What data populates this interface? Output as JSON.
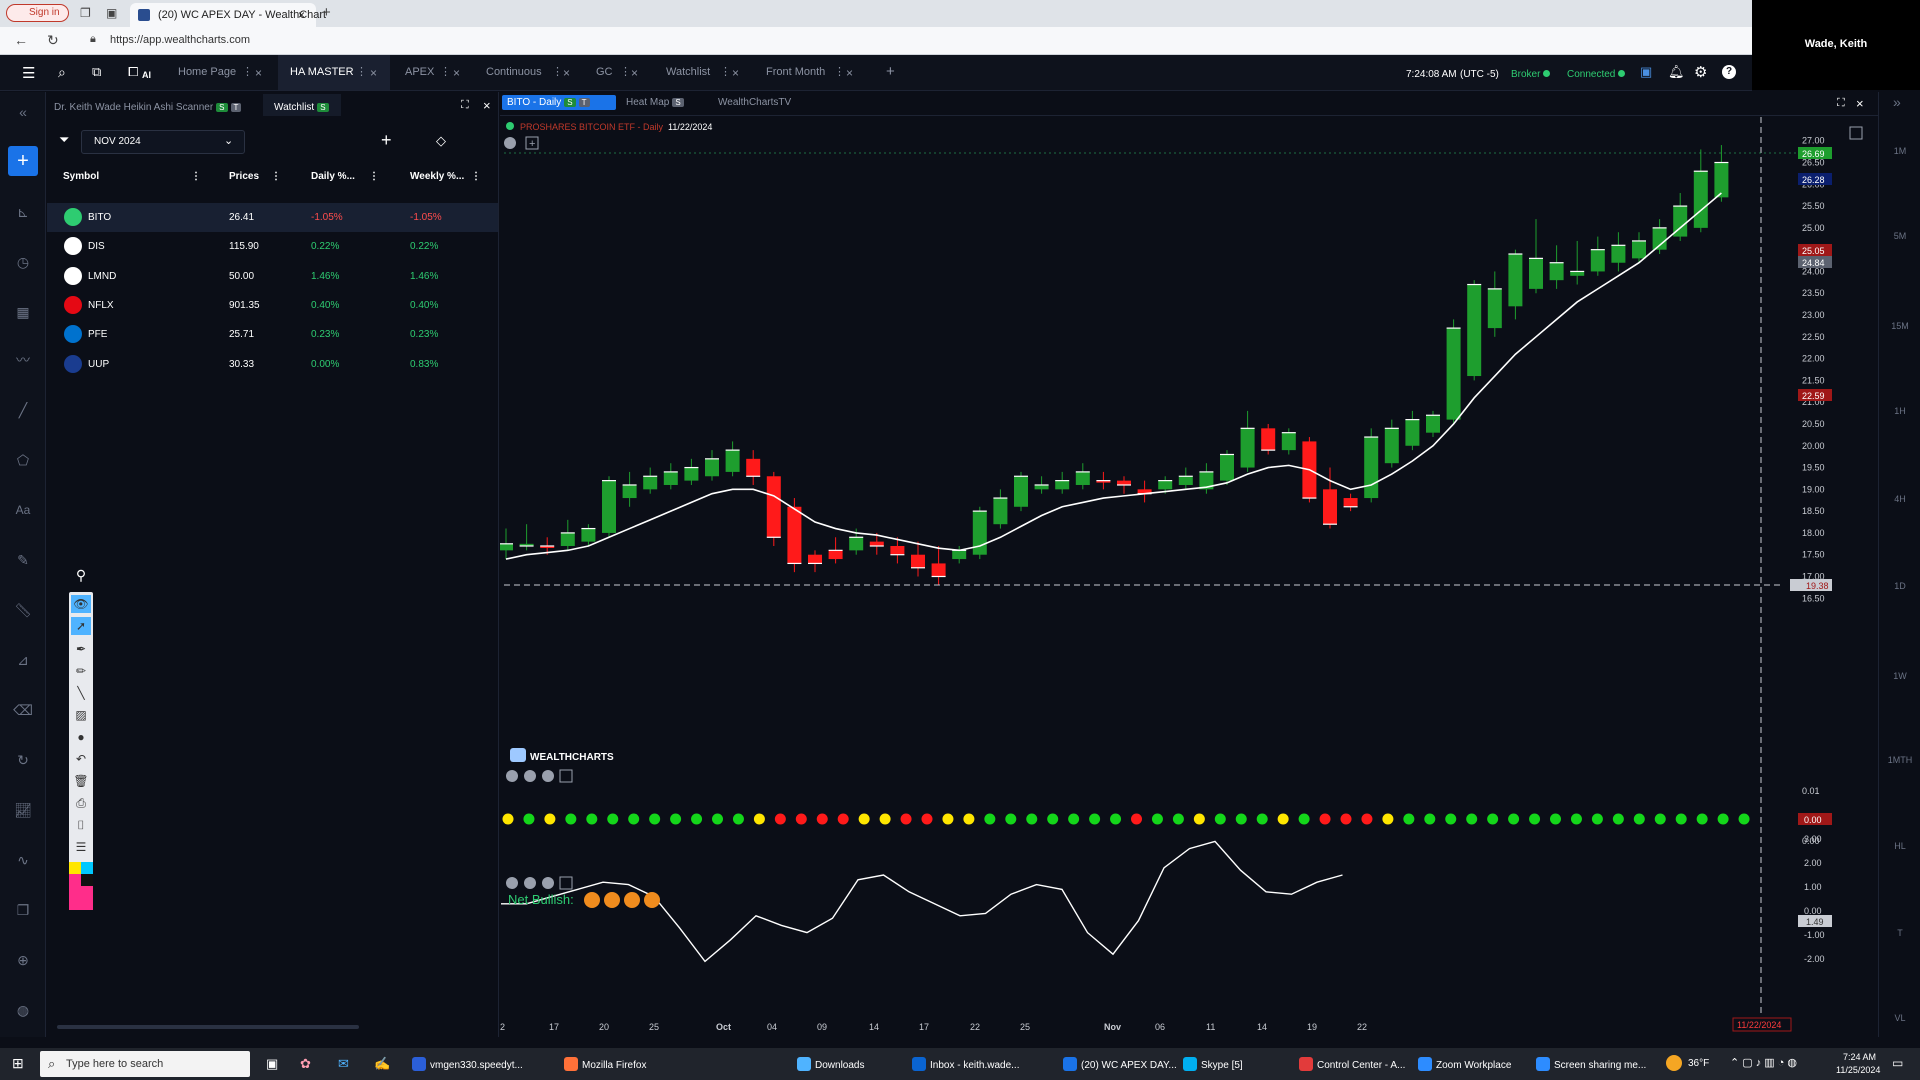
{
  "browser": {
    "signin_label": "Sign in",
    "tab_title": "(20) WC APEX DAY - WealthChart",
    "url": "https://app.wealthcharts.com",
    "user_name": "Wade, Keith"
  },
  "topbar": {
    "ai_label": "AI",
    "tabs": [
      {
        "label": "Home Page"
      },
      {
        "label": "HA MASTER"
      },
      {
        "label": "APEX"
      },
      {
        "label": "Continuous"
      },
      {
        "label": "GC"
      },
      {
        "label": "Watchlist"
      },
      {
        "label": "Front Month"
      }
    ],
    "time": "7:24:08 AM",
    "tz": "(UTC -5)",
    "broker": "Broker",
    "connected": "Connected"
  },
  "watchlist": {
    "scanner_tab": "Dr. Keith Wade Heikin Ashi Scanner",
    "watchlist_tab": "Watchlist",
    "badge_s": "S",
    "badge_t": "T",
    "month": "NOV 2024",
    "columns": [
      "Symbol",
      "Prices",
      "Daily %...",
      "Weekly %..."
    ],
    "rows": [
      {
        "symbol": "BITO",
        "price": "26.41",
        "daily": "-1.05%",
        "weekly": "-1.05%",
        "dir": "down"
      },
      {
        "symbol": "DIS",
        "price": "115.90",
        "daily": "0.22%",
        "weekly": "0.22%",
        "dir": "up"
      },
      {
        "symbol": "LMND",
        "price": "50.00",
        "daily": "1.46%",
        "weekly": "1.46%",
        "dir": "up"
      },
      {
        "symbol": "NFLX",
        "price": "901.35",
        "daily": "0.40%",
        "weekly": "0.40%",
        "dir": "up"
      },
      {
        "symbol": "PFE",
        "price": "25.71",
        "daily": "0.23%",
        "weekly": "0.23%",
        "dir": "up"
      },
      {
        "symbol": "UUP",
        "price": "30.33",
        "daily": "0.00%",
        "weekly": "0.83%",
        "dir": "up"
      }
    ]
  },
  "chart": {
    "tabs": [
      "BITO - Daily",
      "Heat Map",
      "WealthChartsTV"
    ],
    "instrument": "PROSHARES BITCOIN ETF - Daily",
    "date": "11/22/2024",
    "brand": "WEALTHCHARTS",
    "net_bullish": "Net Bullish:",
    "price_labels": {
      "last": "26.69",
      "blue": "26.28",
      "red1": "25.05",
      "gray": "24.84",
      "red2": "22.59",
      "cursor": "19.38",
      "ind1": "0.00",
      "ind2": "1.49",
      "date_tag": "11/22/2024"
    },
    "timeframes": [
      "1M",
      "5M",
      "15M",
      "1H",
      "4H",
      "1D",
      "1W",
      "1MTH",
      "HL",
      "T",
      "VL"
    ]
  },
  "chart_data": {
    "type": "candlestick",
    "title": "PROSHARES BITCOIN ETF - Daily",
    "y_ticks": [
      "27.00",
      "26.50",
      "26.00",
      "25.50",
      "25.00",
      "24.50",
      "24.00",
      "23.50",
      "23.00",
      "22.50",
      "22.00",
      "21.50",
      "21.00",
      "20.50",
      "20.00",
      "19.50",
      "19.00",
      "18.50",
      "18.00",
      "17.50",
      "17.00",
      "16.50"
    ],
    "x_ticks": [
      "2",
      "17",
      "20",
      "25",
      "Oct",
      "04",
      "09",
      "14",
      "17",
      "22",
      "25",
      "Nov",
      "06",
      "11",
      "14",
      "19",
      "22"
    ],
    "ylim": [
      16.3,
      27.2
    ],
    "candles": [
      {
        "o": 17.6,
        "h": 18.1,
        "l": 17.4,
        "c": 17.75,
        "up": true
      },
      {
        "o": 17.75,
        "h": 18.2,
        "l": 17.6,
        "c": 17.7,
        "up": true
      },
      {
        "o": 17.7,
        "h": 17.9,
        "l": 17.5,
        "c": 17.7,
        "up": false
      },
      {
        "o": 17.7,
        "h": 18.3,
        "l": 17.6,
        "c": 18.0,
        "up": true
      },
      {
        "o": 17.8,
        "h": 18.2,
        "l": 17.7,
        "c": 18.1,
        "up": true
      },
      {
        "o": 18.0,
        "h": 19.3,
        "l": 17.9,
        "c": 19.2,
        "up": true
      },
      {
        "o": 18.8,
        "h": 19.4,
        "l": 18.6,
        "c": 19.1,
        "up": true
      },
      {
        "o": 19.0,
        "h": 19.5,
        "l": 18.9,
        "c": 19.3,
        "up": true
      },
      {
        "o": 19.1,
        "h": 19.6,
        "l": 19.0,
        "c": 19.4,
        "up": true
      },
      {
        "o": 19.2,
        "h": 19.7,
        "l": 19.1,
        "c": 19.5,
        "up": true
      },
      {
        "o": 19.3,
        "h": 19.9,
        "l": 19.2,
        "c": 19.7,
        "up": true
      },
      {
        "o": 19.4,
        "h": 20.1,
        "l": 19.3,
        "c": 19.9,
        "up": true
      },
      {
        "o": 19.7,
        "h": 19.9,
        "l": 19.1,
        "c": 19.3,
        "up": false
      },
      {
        "o": 19.3,
        "h": 19.4,
        "l": 17.7,
        "c": 17.9,
        "up": false
      },
      {
        "o": 18.6,
        "h": 18.8,
        "l": 17.1,
        "c": 17.3,
        "up": false
      },
      {
        "o": 17.5,
        "h": 17.6,
        "l": 17.1,
        "c": 17.3,
        "up": false
      },
      {
        "o": 17.4,
        "h": 17.9,
        "l": 17.3,
        "c": 17.6,
        "up": false
      },
      {
        "o": 17.6,
        "h": 18.1,
        "l": 17.5,
        "c": 17.9,
        "up": true
      },
      {
        "o": 17.8,
        "h": 18.0,
        "l": 17.5,
        "c": 17.7,
        "up": false
      },
      {
        "o": 17.7,
        "h": 17.9,
        "l": 17.3,
        "c": 17.5,
        "up": false
      },
      {
        "o": 17.5,
        "h": 17.8,
        "l": 17.0,
        "c": 17.2,
        "up": false
      },
      {
        "o": 17.3,
        "h": 17.7,
        "l": 16.8,
        "c": 17.0,
        "up": false
      },
      {
        "o": 17.4,
        "h": 17.7,
        "l": 17.3,
        "c": 17.6,
        "up": true
      },
      {
        "o": 17.5,
        "h": 18.6,
        "l": 17.4,
        "c": 18.5,
        "up": true
      },
      {
        "o": 18.2,
        "h": 19.0,
        "l": 18.1,
        "c": 18.8,
        "up": true
      },
      {
        "o": 18.6,
        "h": 19.4,
        "l": 18.5,
        "c": 19.3,
        "up": true
      },
      {
        "o": 19.0,
        "h": 19.3,
        "l": 18.9,
        "c": 19.1,
        "up": true
      },
      {
        "o": 19.0,
        "h": 19.4,
        "l": 18.9,
        "c": 19.2,
        "up": true
      },
      {
        "o": 19.1,
        "h": 19.6,
        "l": 19.0,
        "c": 19.4,
        "up": true
      },
      {
        "o": 19.2,
        "h": 19.4,
        "l": 19.0,
        "c": 19.2,
        "up": false
      },
      {
        "o": 19.2,
        "h": 19.3,
        "l": 18.9,
        "c": 19.1,
        "up": false
      },
      {
        "o": 19.0,
        "h": 19.2,
        "l": 18.7,
        "c": 18.9,
        "up": false
      },
      {
        "o": 19.0,
        "h": 19.3,
        "l": 18.9,
        "c": 19.2,
        "up": true
      },
      {
        "o": 19.1,
        "h": 19.5,
        "l": 19.0,
        "c": 19.3,
        "up": true
      },
      {
        "o": 19.0,
        "h": 19.6,
        "l": 18.9,
        "c": 19.4,
        "up": true
      },
      {
        "o": 19.2,
        "h": 19.9,
        "l": 19.1,
        "c": 19.8,
        "up": true
      },
      {
        "o": 19.5,
        "h": 20.8,
        "l": 19.4,
        "c": 20.4,
        "up": true
      },
      {
        "o": 20.4,
        "h": 20.5,
        "l": 19.8,
        "c": 19.9,
        "up": false
      },
      {
        "o": 19.9,
        "h": 20.4,
        "l": 19.8,
        "c": 20.3,
        "up": true
      },
      {
        "o": 20.1,
        "h": 20.2,
        "l": 18.7,
        "c": 18.8,
        "up": false
      },
      {
        "o": 19.0,
        "h": 19.5,
        "l": 18.1,
        "c": 18.2,
        "up": false
      },
      {
        "o": 18.8,
        "h": 18.9,
        "l": 18.5,
        "c": 18.6,
        "up": false
      },
      {
        "o": 18.8,
        "h": 20.4,
        "l": 18.7,
        "c": 20.2,
        "up": true
      },
      {
        "o": 19.6,
        "h": 20.6,
        "l": 19.5,
        "c": 20.4,
        "up": true
      },
      {
        "o": 20.0,
        "h": 20.8,
        "l": 19.9,
        "c": 20.6,
        "up": true
      },
      {
        "o": 20.3,
        "h": 20.8,
        "l": 20.2,
        "c": 20.7,
        "up": true
      },
      {
        "o": 20.6,
        "h": 22.9,
        "l": 20.5,
        "c": 22.7,
        "up": true
      },
      {
        "o": 21.6,
        "h": 23.8,
        "l": 21.5,
        "c": 23.7,
        "up": true
      },
      {
        "o": 22.7,
        "h": 24.0,
        "l": 22.5,
        "c": 23.6,
        "up": true
      },
      {
        "o": 23.2,
        "h": 24.5,
        "l": 22.9,
        "c": 24.4,
        "up": true
      },
      {
        "o": 23.6,
        "h": 25.2,
        "l": 23.5,
        "c": 24.3,
        "up": true
      },
      {
        "o": 23.8,
        "h": 24.6,
        "l": 23.6,
        "c": 24.2,
        "up": true
      },
      {
        "o": 23.9,
        "h": 24.7,
        "l": 23.7,
        "c": 24.0,
        "up": true
      },
      {
        "o": 24.0,
        "h": 24.8,
        "l": 23.9,
        "c": 24.5,
        "up": true
      },
      {
        "o": 24.2,
        "h": 24.9,
        "l": 24.0,
        "c": 24.6,
        "up": true
      },
      {
        "o": 24.3,
        "h": 24.9,
        "l": 24.2,
        "c": 24.7,
        "up": true
      },
      {
        "o": 24.5,
        "h": 25.2,
        "l": 24.4,
        "c": 25.0,
        "up": true
      },
      {
        "o": 24.8,
        "h": 25.8,
        "l": 24.7,
        "c": 25.5,
        "up": true
      },
      {
        "o": 25.0,
        "h": 26.8,
        "l": 24.9,
        "c": 26.3,
        "up": true
      },
      {
        "o": 25.7,
        "h": 26.9,
        "l": 25.6,
        "c": 26.5,
        "up": true
      }
    ],
    "ma": [
      17.4,
      17.5,
      17.55,
      17.6,
      17.7,
      17.9,
      18.1,
      18.3,
      18.5,
      18.7,
      18.9,
      19.0,
      19.0,
      18.85,
      18.55,
      18.25,
      18.1,
      18.0,
      17.95,
      17.85,
      17.75,
      17.65,
      17.6,
      17.7,
      17.9,
      18.15,
      18.4,
      18.6,
      18.7,
      18.8,
      18.85,
      18.9,
      18.95,
      19.0,
      19.05,
      19.15,
      19.35,
      19.5,
      19.55,
      19.45,
      19.2,
      19.0,
      19.1,
      19.35,
      19.65,
      20.0,
      20.5,
      21.1,
      21.6,
      22.1,
      22.5,
      22.9,
      23.3,
      23.6,
      23.9,
      24.2,
      24.6,
      25.0,
      25.4,
      25.8
    ],
    "dots": [
      "y",
      "g",
      "y",
      "g",
      "g",
      "g",
      "g",
      "g",
      "g",
      "g",
      "g",
      "g",
      "y",
      "r",
      "r",
      "r",
      "r",
      "y",
      "y",
      "r",
      "r",
      "y",
      "y",
      "g",
      "g",
      "g",
      "g",
      "g",
      "g",
      "g",
      "r",
      "g",
      "g",
      "y",
      "g",
      "g",
      "g",
      "y",
      "g",
      "r",
      "r",
      "r",
      "y",
      "g",
      "g",
      "g",
      "g",
      "g",
      "g",
      "g",
      "g",
      "g",
      "g",
      "g",
      "g",
      "g",
      "g",
      "g",
      "g",
      "g"
    ],
    "indicator": [
      0.3,
      0.3,
      0.6,
      0.9,
      1.2,
      1.1,
      0.6,
      -0.7,
      -2.1,
      -1.2,
      -0.2,
      -0.6,
      -0.9,
      -0.3,
      1.3,
      1.5,
      0.8,
      0.3,
      -0.2,
      -0.1,
      0.7,
      1.1,
      0.9,
      -0.9,
      -1.8,
      -0.4,
      1.8,
      2.6,
      2.9,
      1.7,
      0.8,
      0.7,
      1.2,
      1.5
    ],
    "ind_ticks": [
      "3.00",
      "2.00",
      "1.00",
      "0.00",
      "-1.00",
      "-2.00"
    ]
  },
  "taskbar": {
    "search_placeholder": "Type here to search",
    "apps": [
      "vmgen330.speedyt...",
      "Mozilla Firefox",
      "Downloads",
      "Inbox - keith.wade...",
      "(20) WC APEX DAY...",
      "Skype [5]",
      "Control Center - A...",
      "Zoom Workplace",
      "Screen sharing me..."
    ],
    "temp": "36°F",
    "time": "7:24 AM",
    "date": "11/25/2024"
  },
  "colors": {
    "up": "#1e9e2e",
    "down": "#ff1a1a",
    "accent": "#1a73e8"
  }
}
